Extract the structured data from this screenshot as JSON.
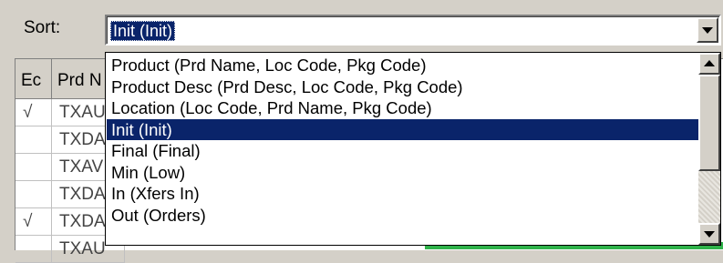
{
  "sort": {
    "label": "Sort:",
    "selected": "Init  (Init)",
    "options": [
      {
        "label": "Product  (Prd Name, Loc Code, Pkg Code)"
      },
      {
        "label": "Product Desc  (Prd Desc, Loc Code, Pkg Code)"
      },
      {
        "label": "Location  (Loc Code, Prd Name, Pkg Code)"
      },
      {
        "label": "Init  (Init)",
        "selected": true
      },
      {
        "label": "Final  (Final)"
      },
      {
        "label": "Min  (Low)"
      },
      {
        "label": "In  (Xfers In)"
      },
      {
        "label": "Out  (Orders)"
      }
    ]
  },
  "grid": {
    "headers": [
      "Ec",
      "Prd N"
    ],
    "rows": [
      {
        "check": "√",
        "prd": "TXAU"
      },
      {
        "check": "",
        "prd": "TXDA"
      },
      {
        "check": "",
        "prd": "TXAV"
      },
      {
        "check": "",
        "prd": "TXDA"
      },
      {
        "check": "√",
        "prd": "TXDA"
      },
      {
        "check": "",
        "prd": "TXAU"
      }
    ]
  },
  "colors": {
    "selection": "#0a246a",
    "window": "#d4d0c8",
    "status_green": "#2fb24a"
  }
}
